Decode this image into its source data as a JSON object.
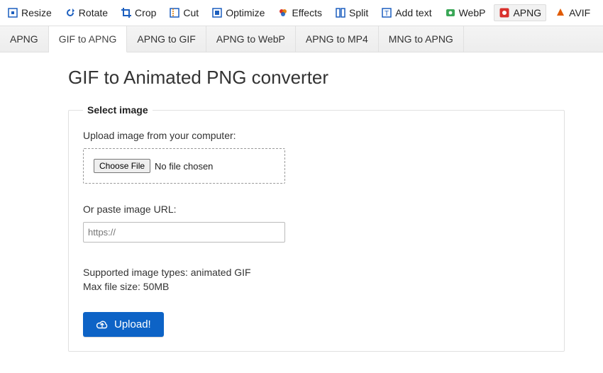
{
  "toolbar": [
    {
      "label": "Resize",
      "icon": "resize-icon",
      "active": false
    },
    {
      "label": "Rotate",
      "icon": "rotate-icon",
      "active": false
    },
    {
      "label": "Crop",
      "icon": "crop-icon",
      "active": false
    },
    {
      "label": "Cut",
      "icon": "cut-icon",
      "active": false
    },
    {
      "label": "Optimize",
      "icon": "optimize-icon",
      "active": false
    },
    {
      "label": "Effects",
      "icon": "effects-icon",
      "active": false
    },
    {
      "label": "Split",
      "icon": "split-icon",
      "active": false
    },
    {
      "label": "Add text",
      "icon": "addtext-icon",
      "active": false
    },
    {
      "label": "WebP",
      "icon": "webp-icon",
      "active": false
    },
    {
      "label": "APNG",
      "icon": "apng-icon",
      "active": true
    },
    {
      "label": "AVIF",
      "icon": "avif-icon",
      "active": false
    }
  ],
  "subtabs": [
    {
      "label": "APNG",
      "active": false
    },
    {
      "label": "GIF to APNG",
      "active": true
    },
    {
      "label": "APNG to GIF",
      "active": false
    },
    {
      "label": "APNG to WebP",
      "active": false
    },
    {
      "label": "APNG to MP4",
      "active": false
    },
    {
      "label": "MNG to APNG",
      "active": false
    }
  ],
  "page": {
    "title": "GIF to Animated PNG converter",
    "fieldset_legend": "Select image",
    "upload_label": "Upload image from your computer:",
    "choose_file_label": "Choose File",
    "file_status": "No file chosen",
    "or_paste_label": "Or paste image URL:",
    "url_placeholder": "https://",
    "supported_line": "Supported image types: animated GIF",
    "max_size_line": "Max file size: 50MB",
    "upload_button_label": "Upload!"
  },
  "colors": {
    "primary": "#0d63c6",
    "apng_red": "#d9302c"
  }
}
